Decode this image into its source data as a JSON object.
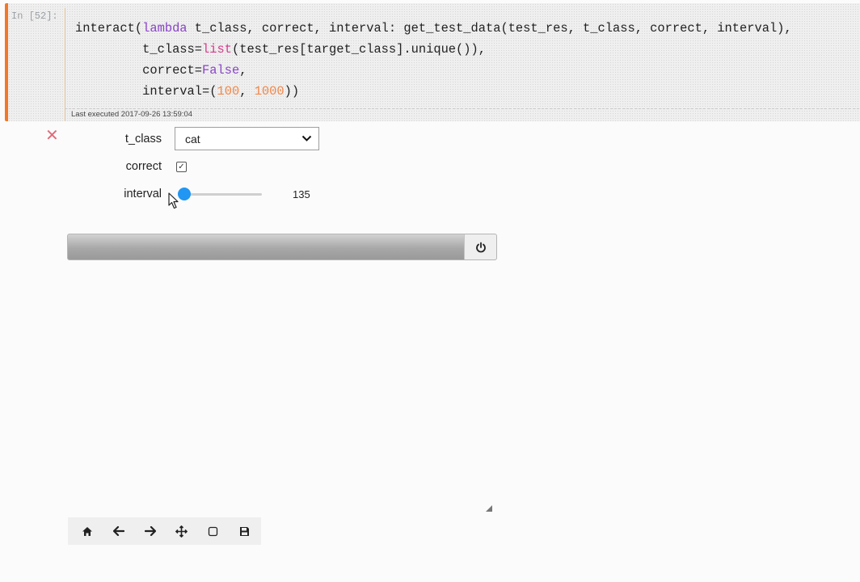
{
  "cell": {
    "prompt": "In [52]:",
    "last_executed": "Last executed 2017-09-26 13:59:04"
  },
  "widgets": {
    "t_class": {
      "label": "t_class",
      "value": "cat"
    },
    "correct": {
      "label": "correct",
      "checked": true
    },
    "interval": {
      "label": "interval",
      "value": 135,
      "min": 100,
      "max": 1000
    }
  },
  "figure": {
    "toolbar": [
      {
        "name": "home-icon"
      },
      {
        "name": "arrow-left-icon"
      },
      {
        "name": "arrow-right-icon"
      },
      {
        "name": "move-icon"
      },
      {
        "name": "zoom-rect-icon"
      },
      {
        "name": "save-icon"
      }
    ]
  },
  "colors": {
    "cell_accent": "#f37726",
    "slider_accent": "#2196f3",
    "keyword": "#8a44c9",
    "builtin": "#d63a8a",
    "number": "#f0884a"
  }
}
